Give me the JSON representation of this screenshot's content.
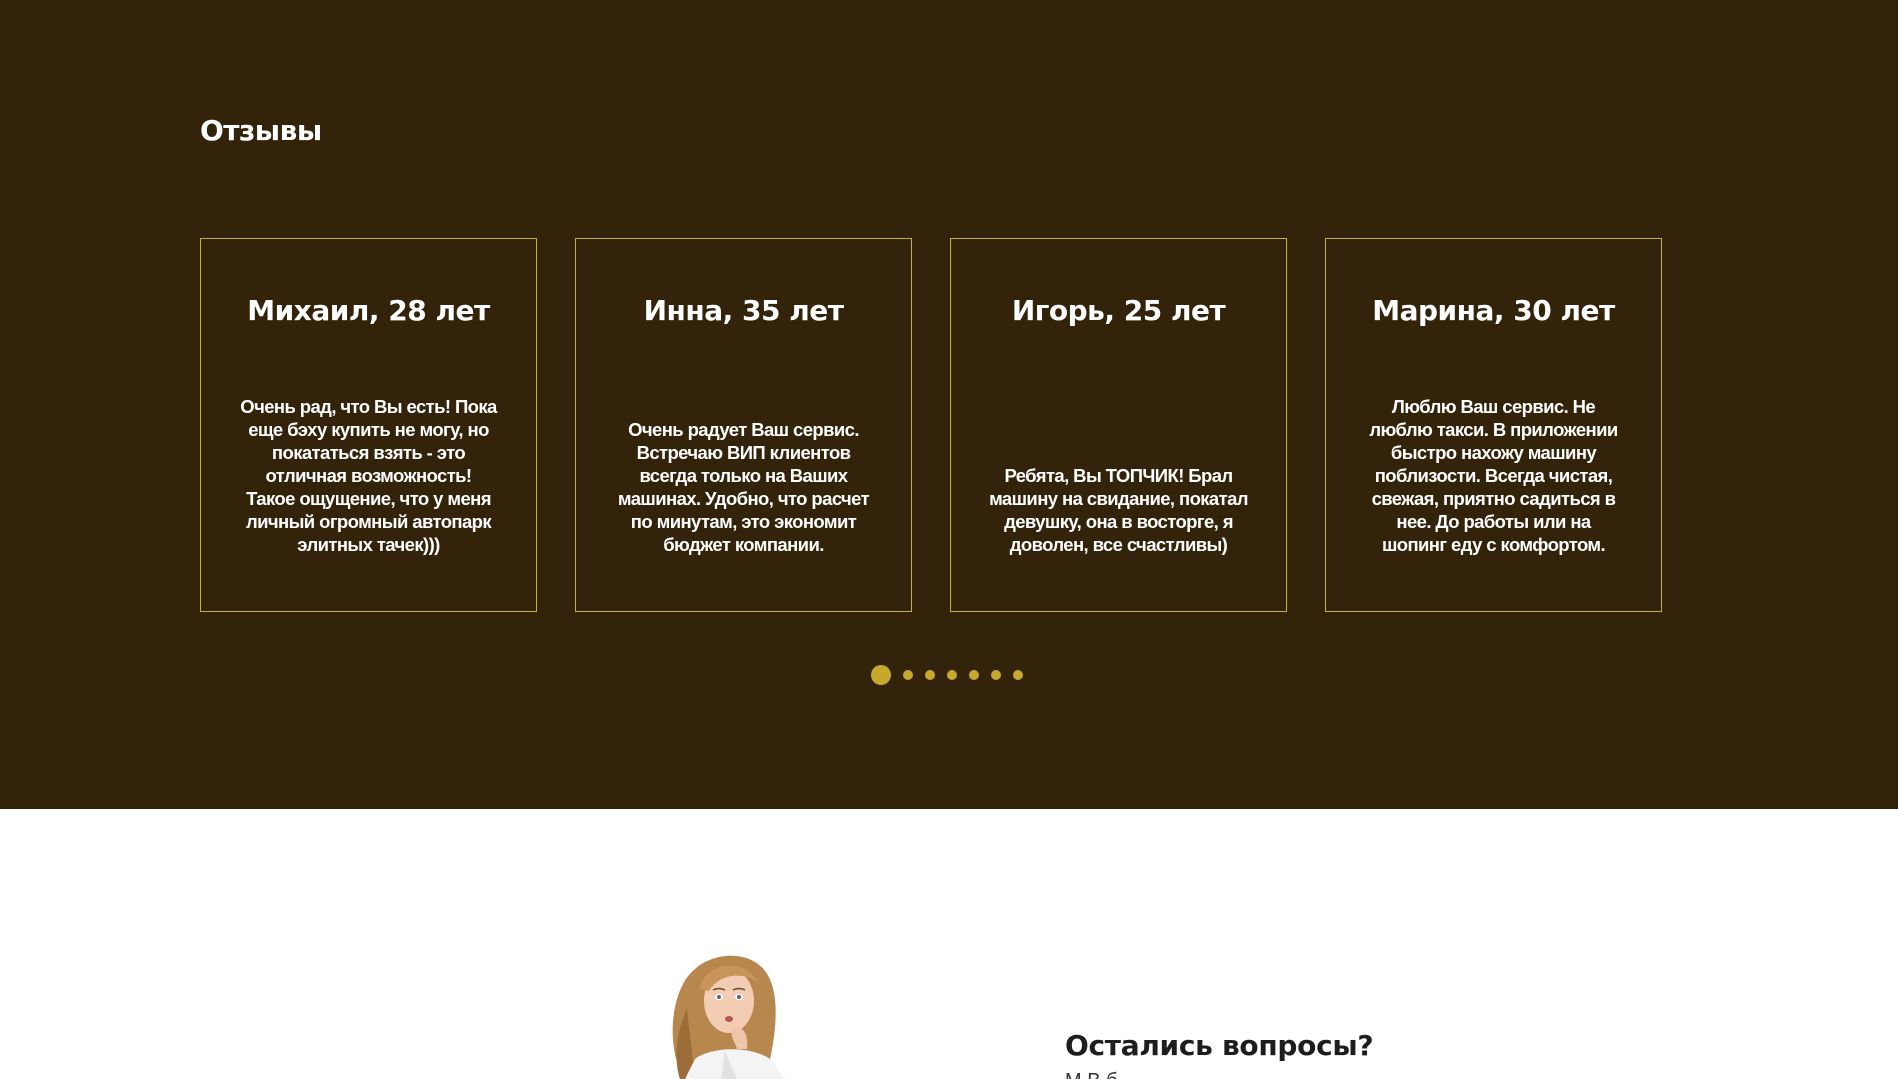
{
  "reviews": {
    "title": "Отзывы",
    "cards": [
      {
        "name": "Михаил, 28 лет",
        "text": "Очень рад, что Вы есть! Пока еще бэху купить не могу, но покататься взять - это отличная возможность! Такое ощущение, что у меня личный огромный автопарк элитных тачек)))"
      },
      {
        "name": "Инна, 35 лет",
        "text": "Очень радует Ваш сервис. Встречаю ВИП клиентов всегда только на Ваших машинах. Удобно, что расчет по минутам, это экономит бюджет компании."
      },
      {
        "name": "Игорь, 25 лет",
        "text": "Ребята, Вы ТОПЧИК! Брал машину на свидание, покатал девушку, она в восторге, я доволен, все счастливы)"
      },
      {
        "name": "Марина, 30 лет",
        "text": "Люблю Ваш сервис. Не люблю такси. В приложении быстро нахожу машину поблизости. Всегда чистая, свежая, приятно садиться в нее. До работы или на шопинг еду с комфортом."
      }
    ],
    "pagination": {
      "total": 7,
      "active": 1
    }
  },
  "questions": {
    "title": "Остались вопросы?",
    "subtitle": "М                         В                                                            б"
  },
  "colors": {
    "reviews_bg": "#34230b",
    "accent": "#c8a82c",
    "card_border": "#c8b02c"
  },
  "icons": {
    "person_image": "woman-thinking-photo"
  }
}
